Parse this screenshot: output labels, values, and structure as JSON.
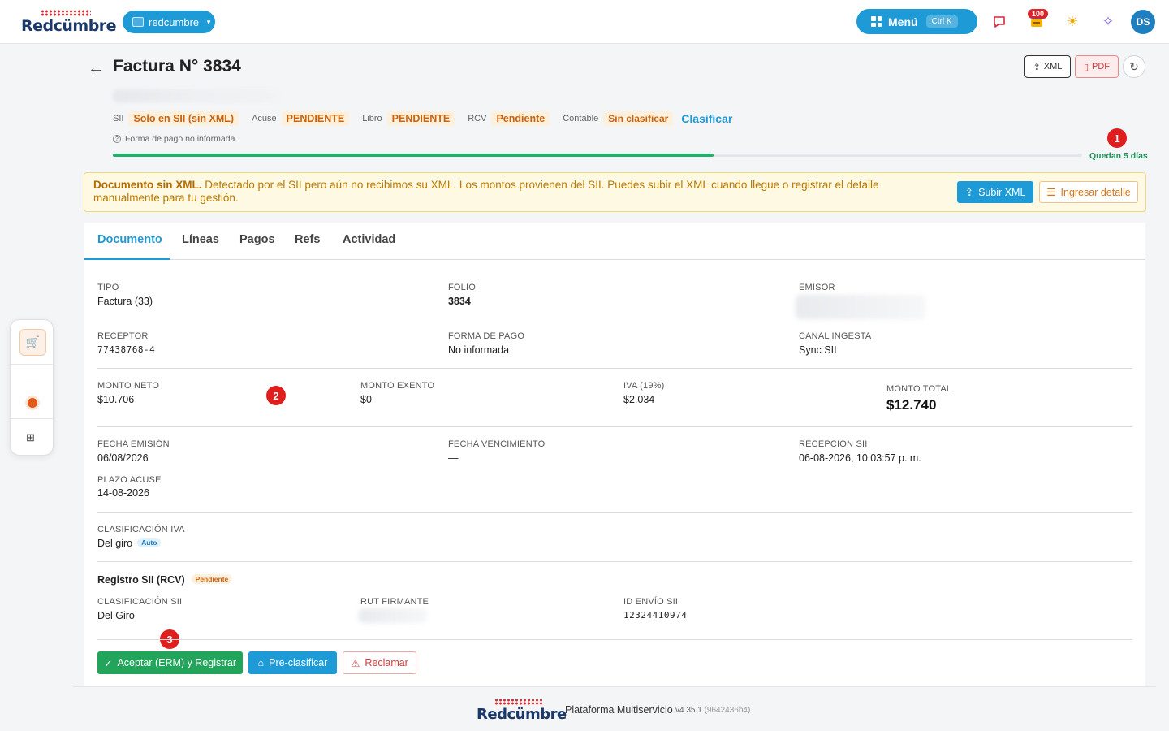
{
  "topbar": {
    "brand": "Redcümbre",
    "org": "redcumbre",
    "menu_label": "Menú",
    "menu_shortcut": "Ctrl K",
    "notif_count": "100",
    "avatar_initials": "DS"
  },
  "header": {
    "title": "Factura N° 3834",
    "xml_button": "XML",
    "pdf_button": "PDF"
  },
  "status": {
    "sii_label": "SII",
    "sii_value": "Solo en SII (sin XML)",
    "acuse_label": "Acuse",
    "acuse_value": "PENDIENTE",
    "libro_label": "Libro",
    "libro_value": "PENDIENTE",
    "rcv_label": "RCV",
    "rcv_value": "Pendiente",
    "contable_label": "Contable",
    "contable_value": "Sin clasificar",
    "classify_link": "Clasificar",
    "payment_note": "Forma de pago no informada",
    "deadline_text": "Quedan 5 días",
    "progress_fraction": 0.62
  },
  "markers": {
    "m1": "1",
    "m2": "2",
    "m3": "3"
  },
  "alert": {
    "title": "Documento sin XML.",
    "body": " Detectado por el SII pero aún no recibimos su XML. Los montos provienen del SII. Puedes subir el XML cuando llegue o registrar el detalle manualmente para tu gestión.",
    "upload_button": "Subir XML",
    "detail_button": "Ingresar detalle"
  },
  "tabs": [
    "Documento",
    "Líneas",
    "Pagos",
    "Refs",
    "Actividad"
  ],
  "document": {
    "tipo_label": "TIPO",
    "tipo_value": "Factura (33)",
    "folio_label": "FOLIO",
    "folio_value": "3834",
    "emisor_label": "EMISOR",
    "receptor_label": "RECEPTOR",
    "receptor_value": "77438768-4",
    "forma_pago_label": "FORMA DE PAGO",
    "forma_pago_value": "No informada",
    "canal_label": "CANAL INGESTA",
    "canal_value": "Sync SII",
    "neto_label": "MONTO NETO",
    "neto_value": "$10.706",
    "exento_label": "MONTO EXENTO",
    "exento_value": "$0",
    "iva_label": "IVA (19%)",
    "iva_value": "$2.034",
    "total_label": "MONTO TOTAL",
    "total_value": "$12.740",
    "emision_label": "FECHA EMISIÓN",
    "emision_value": "06/08/2026",
    "vencimiento_label": "FECHA VENCIMIENTO",
    "vencimiento_value": "—",
    "recepcion_label": "RECEPCIÓN SII",
    "recepcion_value": "06-08-2026, 10:03:57 p. m.",
    "plazo_label": "PLAZO ACUSE",
    "plazo_value": "14-08-2026",
    "clasif_iva_label": "CLASIFICACIÓN IVA",
    "clasif_iva_value": "Del giro",
    "clasif_iva_tag": "Auto",
    "rcv_title": "Registro SII (RCV)",
    "rcv_tag": "Pendiente",
    "clasif_sii_label": "CLASIFICACIÓN SII",
    "clasif_sii_value": "Del Giro",
    "rut_firmante_label": "RUT FIRMANTE",
    "id_envio_label": "ID ENVÍO SII",
    "id_envio_value": "12324410974"
  },
  "actions": {
    "accept": "Aceptar (ERM) y Registrar",
    "preclassify": "Pre-clasificar",
    "claim": "Reclamar"
  },
  "footer": {
    "brand": "Redcümbre",
    "platform": "Plataforma Multiservicio",
    "version": "v4.35.1",
    "build": "(9642436b4)"
  }
}
